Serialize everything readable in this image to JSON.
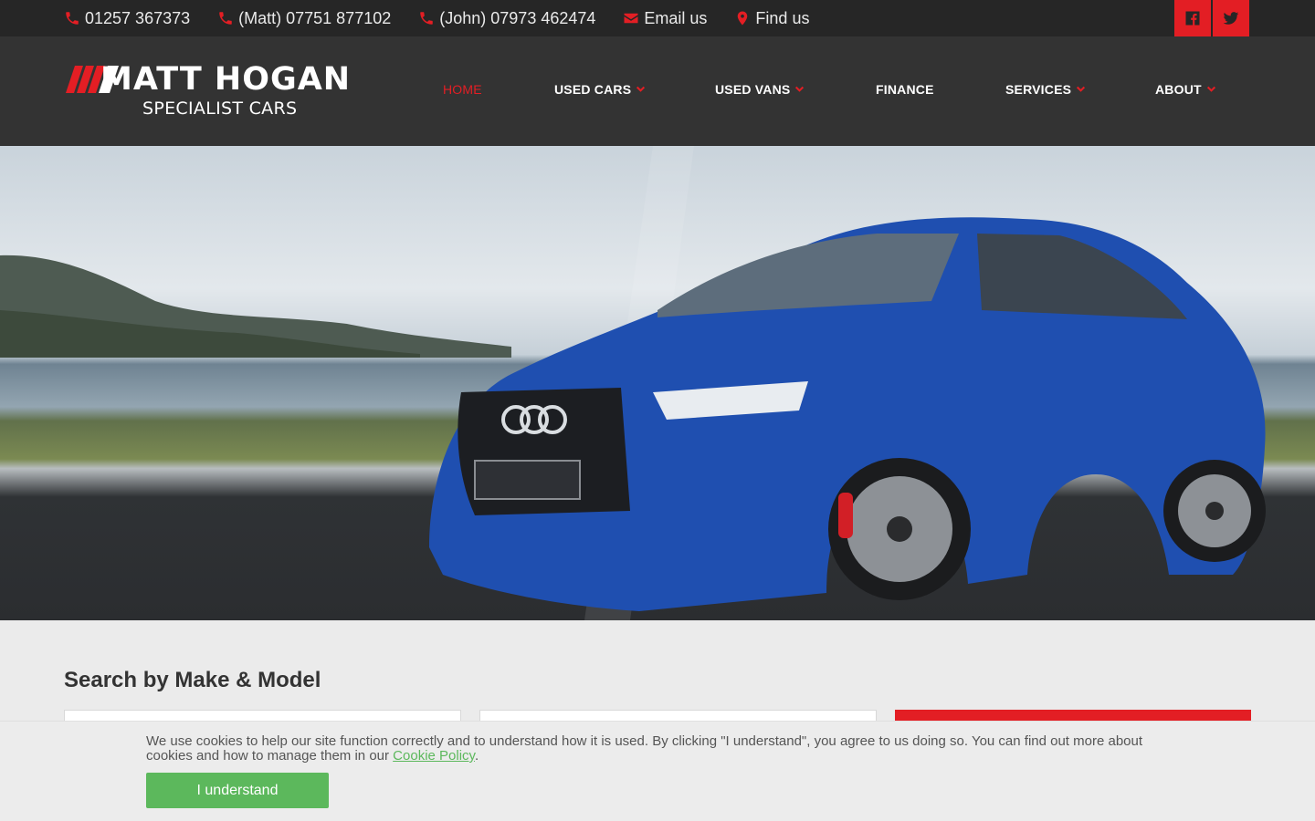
{
  "topbar": {
    "contacts": [
      {
        "label": "01257 367373",
        "icon": "phone-icon"
      },
      {
        "label": "(Matt) 07751 877102",
        "icon": "phone-icon"
      },
      {
        "label": "(John) 07973 462474",
        "icon": "phone-icon"
      },
      {
        "label": "Email us",
        "icon": "envelope-icon"
      },
      {
        "label": "Find us",
        "icon": "map-marker-icon"
      }
    ],
    "social": [
      "facebook-icon",
      "twitter-icon"
    ]
  },
  "brand": {
    "name": "MATT HOGAN",
    "tagline": "SPECIALIST CARS",
    "accent": "#e31e24"
  },
  "nav": [
    {
      "label": "HOME",
      "dropdown": false,
      "active": true
    },
    {
      "label": "USED CARS",
      "dropdown": true
    },
    {
      "label": "USED VANS",
      "dropdown": true
    },
    {
      "label": "FINANCE",
      "dropdown": false
    },
    {
      "label": "SERVICES",
      "dropdown": true
    },
    {
      "label": "ABOUT",
      "dropdown": true
    }
  ],
  "search": {
    "title": "Search by Make & Model"
  },
  "cookie": {
    "text": "We use cookies to help our site function correctly and to understand how it is used. By clicking \"I understand\", you agree to us doing so. You can find out more about cookies and how to manage them in our ",
    "link": "Cookie Policy",
    "after": ".",
    "button": "I understand",
    "button_color": "#5cb85c"
  }
}
